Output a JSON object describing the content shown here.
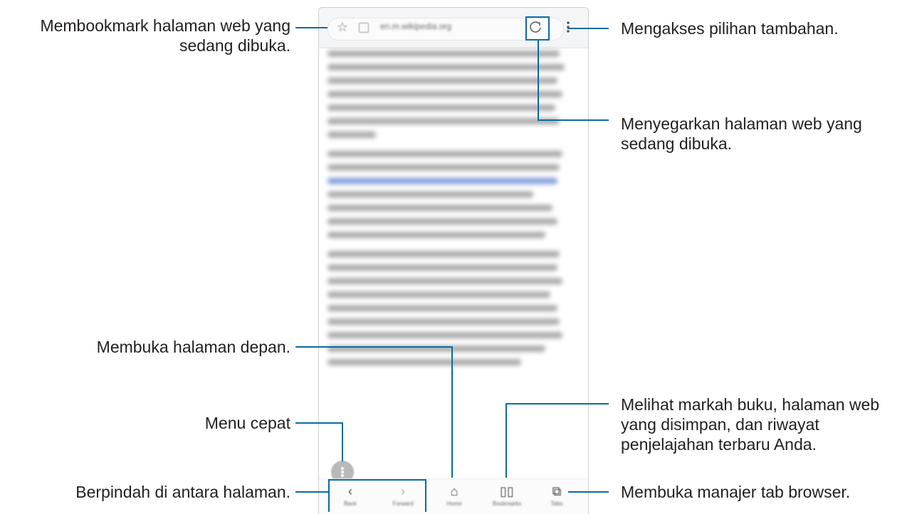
{
  "browser": {
    "url": "en.m.wikipedia.org",
    "nav": [
      {
        "label": "Back",
        "icon": "back-arrow-icon"
      },
      {
        "label": "Forward",
        "icon": "forward-arrow-icon"
      },
      {
        "label": "Home",
        "icon": "home-icon"
      },
      {
        "label": "Bookmarks",
        "icon": "bookmarks-icon"
      },
      {
        "label": "Tabs",
        "icon": "tabs-icon"
      }
    ]
  },
  "callouts": {
    "bookmark": "Membookmark halaman web yang sedang dibuka.",
    "more": "Mengakses pilihan tambahan.",
    "refresh": "Menyegarkan halaman web yang sedang dibuka.",
    "home": "Membuka halaman depan.",
    "bookmarks": "Melihat markah buku, halaman web yang disimpan, dan riwayat penjelajahan terbaru Anda.",
    "quick_menu": "Menu cepat",
    "navigate": "Berpindah di antara halaman.",
    "tabs": "Membuka manajer tab browser."
  },
  "colors": {
    "callout_line": "#0a6ba3",
    "link_blur": "#5f7fd0"
  }
}
